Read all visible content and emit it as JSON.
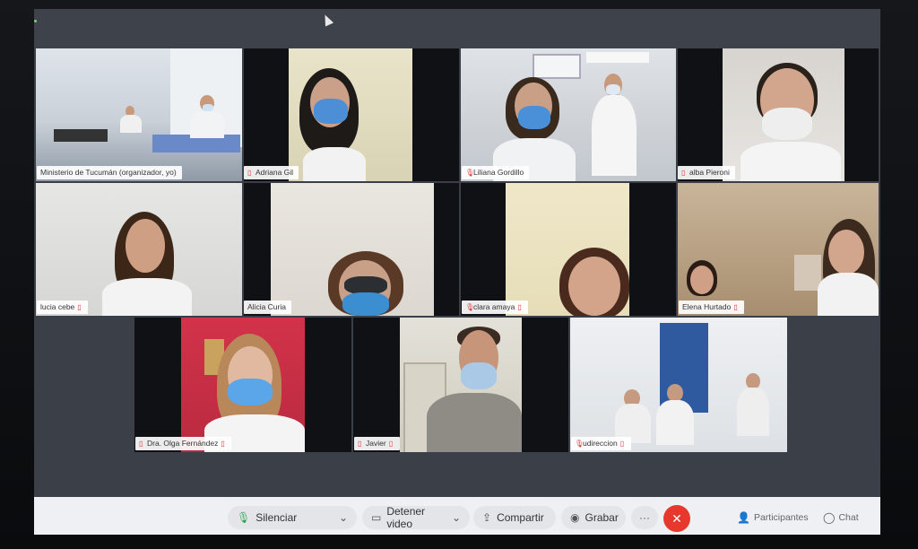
{
  "participants": [
    {
      "name": "Ministerio de Tucumán (organizador, yo)"
    },
    {
      "name": "Adriana Gil"
    },
    {
      "name": "Liliana Gordillo"
    },
    {
      "name": "alba Pieroni"
    },
    {
      "name": "lucia cebe"
    },
    {
      "name": "Alicia Curia"
    },
    {
      "name": "clara amaya"
    },
    {
      "name": "Elena Hurtado"
    },
    {
      "name": "Dra. Olga Fernández"
    },
    {
      "name": "Javier"
    },
    {
      "name": "udireccion"
    }
  ],
  "toolbar": {
    "mute_label": "Silenciar",
    "video_label": "Detener video",
    "share_label": "Compartir",
    "record_label": "Grabar",
    "more_label": "···",
    "end_label": "✕",
    "participants_label": "Participantes",
    "chat_label": "Chat"
  },
  "colors": {
    "end_button": "#e8372c",
    "active_speaker": "#6fc3ff",
    "muted_mic": "#dd3333"
  },
  "icons": {
    "mute": "mic-icon",
    "video": "camera-icon",
    "share": "share-icon",
    "record": "record-icon",
    "participants": "people-icon",
    "chat": "chat-icon"
  }
}
